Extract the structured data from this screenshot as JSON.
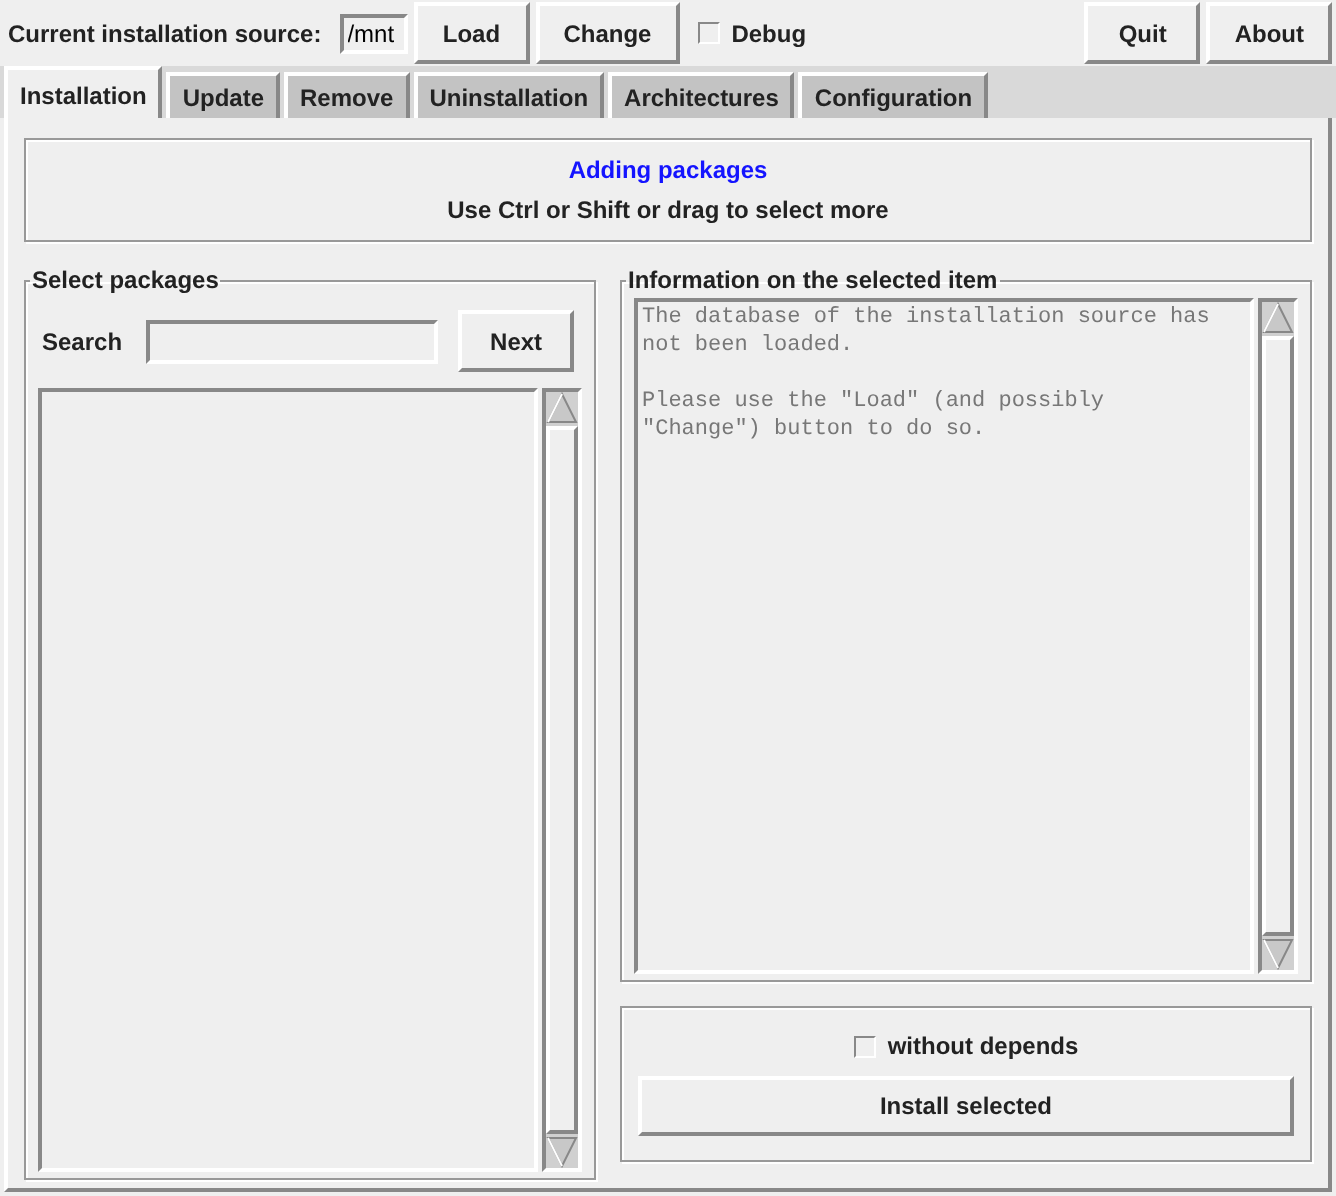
{
  "toolbar": {
    "source_label": "Current installation source:",
    "source_value": "/mnt",
    "buttons_left": [
      "Load",
      "Change"
    ],
    "debug": {
      "label": "Debug",
      "checked": false
    },
    "buttons_right": [
      "Quit",
      "About"
    ]
  },
  "tabs": [
    {
      "label": "Installation",
      "selected": true
    },
    {
      "label": "Update",
      "selected": false
    },
    {
      "label": "Remove",
      "selected": false
    },
    {
      "label": "Uninstallation",
      "selected": false
    },
    {
      "label": "Architectures",
      "selected": false
    },
    {
      "label": "Configuration",
      "selected": false
    }
  ],
  "header": {
    "title": "Adding packages",
    "hint": "Use Ctrl or Shift or drag to select more"
  },
  "packages": {
    "legend": "Select packages",
    "search_label": "Search",
    "next_button": "Next"
  },
  "info": {
    "legend": "Information on the selected item",
    "text": "The database of the installation source has\nnot been loaded.\n\nPlease use the \"Load\" (and possibly\n\"Change\") button to do so."
  },
  "install": {
    "without_depends": {
      "label": "without depends",
      "checked": false
    },
    "button": "Install selected"
  }
}
